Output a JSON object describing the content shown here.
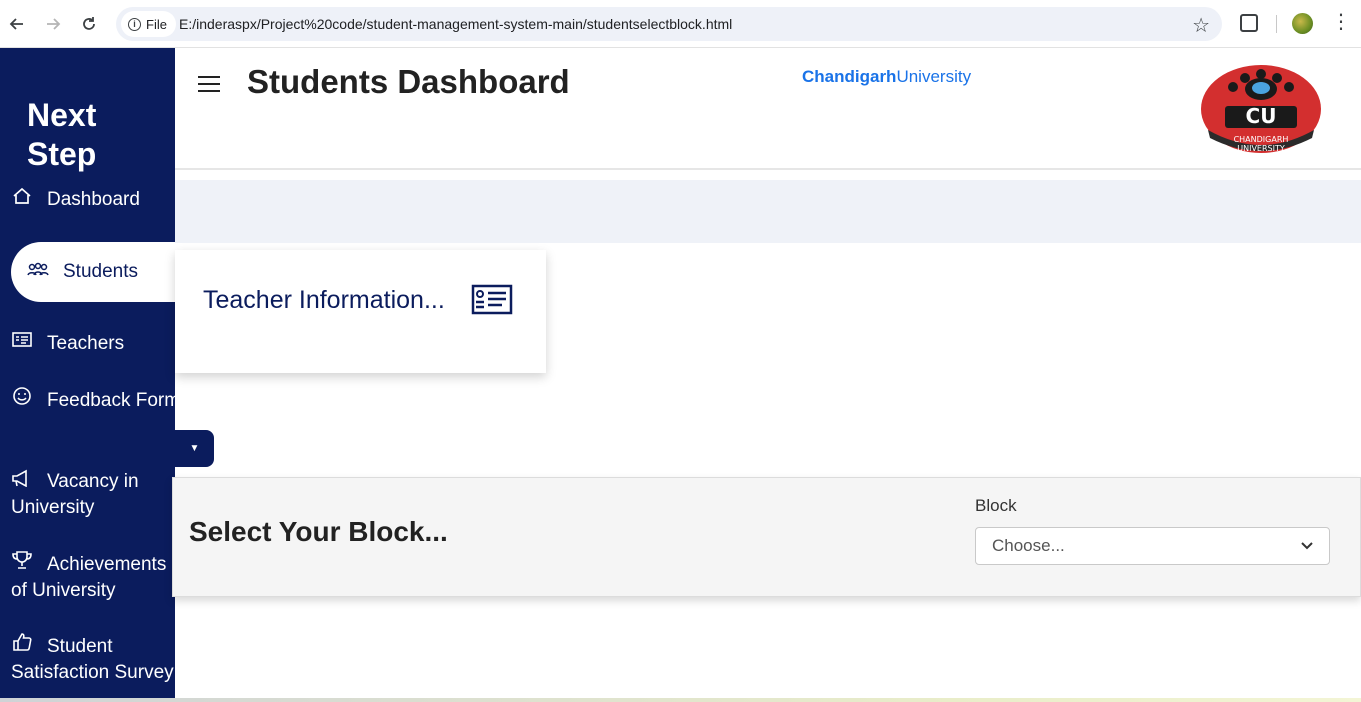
{
  "browser": {
    "file_chip_label": "File",
    "url": "E:/inderaspx/Project%20code/student-management-system-main/studentselectblock.html",
    "icons": [
      "back-arrow-icon",
      "forward-arrow-icon",
      "reload-icon",
      "info-icon",
      "star-icon",
      "extensions-icon",
      "profile-avatar",
      "more-menu-icon"
    ]
  },
  "sidebar": {
    "brand": "Next Step",
    "background": "#0b1c5d",
    "items": [
      {
        "label": "Dashboard",
        "icon": "home-icon"
      },
      {
        "label": "Students",
        "icon": "people-icon",
        "active": true
      },
      {
        "label": "Teachers",
        "icon": "id-card-icon"
      },
      {
        "label": "Feedback Form",
        "icon": "smile-icon"
      },
      {
        "label": "Vacancy in University",
        "icon": "megaphone-icon"
      },
      {
        "label": "Achievements of University",
        "icon": "trophy-icon"
      },
      {
        "label": "Student Satisfaction Survey",
        "icon": "thumbs-up-icon"
      }
    ]
  },
  "header": {
    "title": "Students Dashboard",
    "uni_bold": "Chandigarh",
    "uni_rest": "University",
    "logo_text": "CU",
    "logo_subtext": "CHANDIGARH UNIVERSITY"
  },
  "card": {
    "title": "Teacher Information...",
    "icon": "id-card-icon"
  },
  "block_panel": {
    "heading": "Select Your Block...",
    "label": "Block",
    "select_value": "Choose..."
  },
  "colors": {
    "primary": "#0b1c5d",
    "link": "#1a73e8",
    "logo_red": "#d32f2f"
  }
}
